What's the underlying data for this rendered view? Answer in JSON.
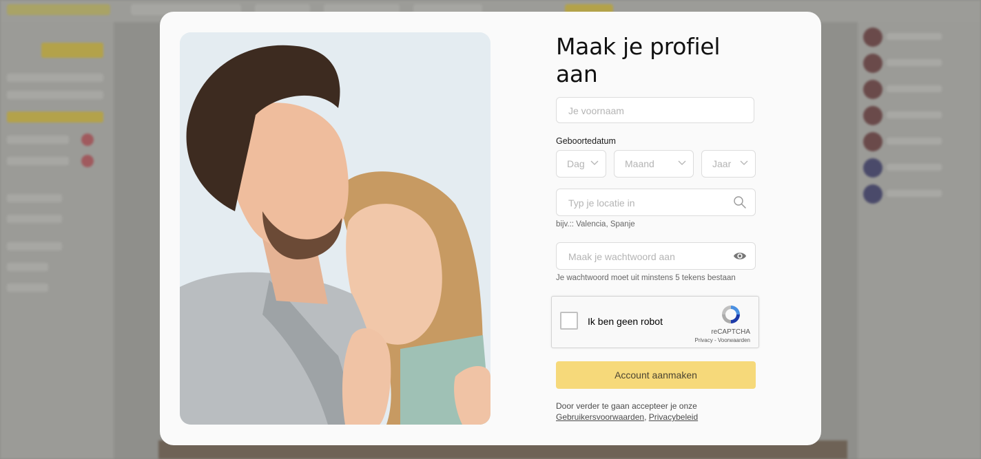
{
  "modal": {
    "title": "Maak je profiel aan",
    "name_placeholder": "Je voornaam",
    "birthdate_label": "Geboortedatum",
    "day_label": "Dag",
    "month_label": "Maand",
    "year_label": "Jaar",
    "location_placeholder": "Typ je locatie in",
    "location_hint": "bijv.:: Valencia, Spanje",
    "password_placeholder": "Maak je wachtwoord aan",
    "password_hint": "Je wachtwoord moet uit minstens 5 tekens bestaan",
    "captcha": {
      "label": "Ik ben geen robot",
      "brand": "reCAPTCHA",
      "privacy": "Privacy",
      "separator": " - ",
      "terms": "Voorwaarden"
    },
    "submit_label": "Account aanmaken",
    "terms_text": "Door verder te gaan accepteer je onze",
    "terms_link": "Gebruikersvoorwaarden",
    "terms_comma": ",",
    "privacy_link": "Privacybeleid",
    "accent_color": "#f6d97a"
  },
  "icons": {
    "search": "search-icon",
    "eye": "eye-icon",
    "chevron": "chevron-down-icon",
    "recaptcha": "recaptcha-logo-icon"
  }
}
